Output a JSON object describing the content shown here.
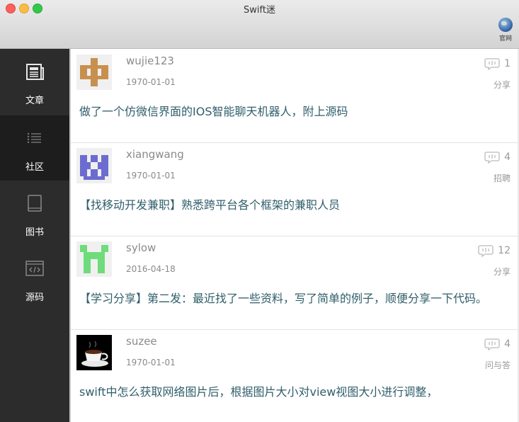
{
  "window": {
    "title": "Swift迷"
  },
  "toolbar": {
    "official_label": "官网"
  },
  "sidebar": {
    "items": [
      {
        "label": "文章",
        "icon": "newspaper-icon"
      },
      {
        "label": "社区",
        "icon": "list-icon"
      },
      {
        "label": "图书",
        "icon": "book-icon"
      },
      {
        "label": "源码",
        "icon": "code-icon"
      }
    ],
    "active_index": 1
  },
  "posts": [
    {
      "username": "wujie123",
      "date": "1970-01-01",
      "comments": "1",
      "category": "分享",
      "content": "做了一个仿微信界面的IOS智能聊天机器人，附上源码",
      "avatar_color": "#c8904f"
    },
    {
      "username": "xiangwang",
      "date": "1970-01-01",
      "comments": "4",
      "category": "招聘",
      "content": "【找移动开发兼职】熟悉跨平台各个框架的兼职人员",
      "avatar_color": "#6c6cd0"
    },
    {
      "username": "sylow",
      "date": "2016-04-18",
      "comments": "12",
      "category": "分享",
      "content": "【学习分享】第二发：最近找了一些资料，写了简单的例子，顺便分享一下代码。",
      "avatar_color": "#6edc7a"
    },
    {
      "username": "suzee",
      "date": "1970-01-01",
      "comments": "4",
      "category": "问与答",
      "content": "swift中怎么获取网络图片后，根据图片大小对view视图大小进行调整，",
      "avatar_color": "#000000"
    }
  ]
}
